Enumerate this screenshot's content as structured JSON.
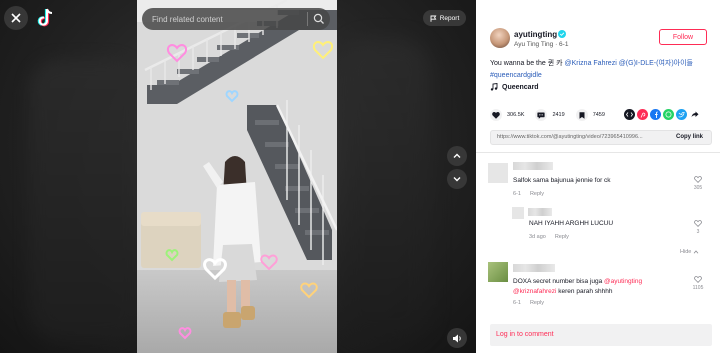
{
  "header": {
    "search_placeholder": "Find related content",
    "report_label": "Report"
  },
  "author": {
    "username": "ayutingting",
    "nickname_line": "Ayu Ting Ting · 6-1",
    "follow_label": "Follow"
  },
  "caption": {
    "text": "You wanna be the 퀸 카 ",
    "mentions": [
      "@Krizna Fahrezi",
      "@(G)I-DLE-(여자)아이들"
    ],
    "hashtag": "#queencardgidle"
  },
  "music": {
    "title": "Queencard"
  },
  "stats": {
    "likes": "306.5K",
    "comments": "2419",
    "saves": "7459"
  },
  "share_icons": [
    "embed-icon",
    "pinterest-icon",
    "facebook-icon",
    "whatsapp-icon",
    "twitter-icon",
    "share-arrow-icon"
  ],
  "link": {
    "url": "https://www.tiktok.com/@ayutingting/video/723965410996...",
    "copy_label": "Copy link"
  },
  "comments": [
    {
      "text": "Salfok sama bajunua jennie for ck",
      "date": "6-1",
      "reply_label": "Reply",
      "likes": "305"
    },
    {
      "text": "NAH IYAHH ARGHH LUCUU",
      "date": "3d ago",
      "reply_label": "Reply",
      "likes": "3"
    },
    {
      "text_prefix": "DOXA secret number bisa juga ",
      "mention1": "@ayutingting",
      "mention2": "@kriznafahrezi",
      "text_suffix": " keren parah shhhh",
      "date": "6-1",
      "reply_label": "Reply",
      "likes": "1105"
    }
  ],
  "hide_label": "Hide",
  "login_label": "Log in to comment",
  "colors": {
    "accent": "#fe2c55",
    "link": "#2b5db9",
    "verified": "#20d5ec"
  }
}
